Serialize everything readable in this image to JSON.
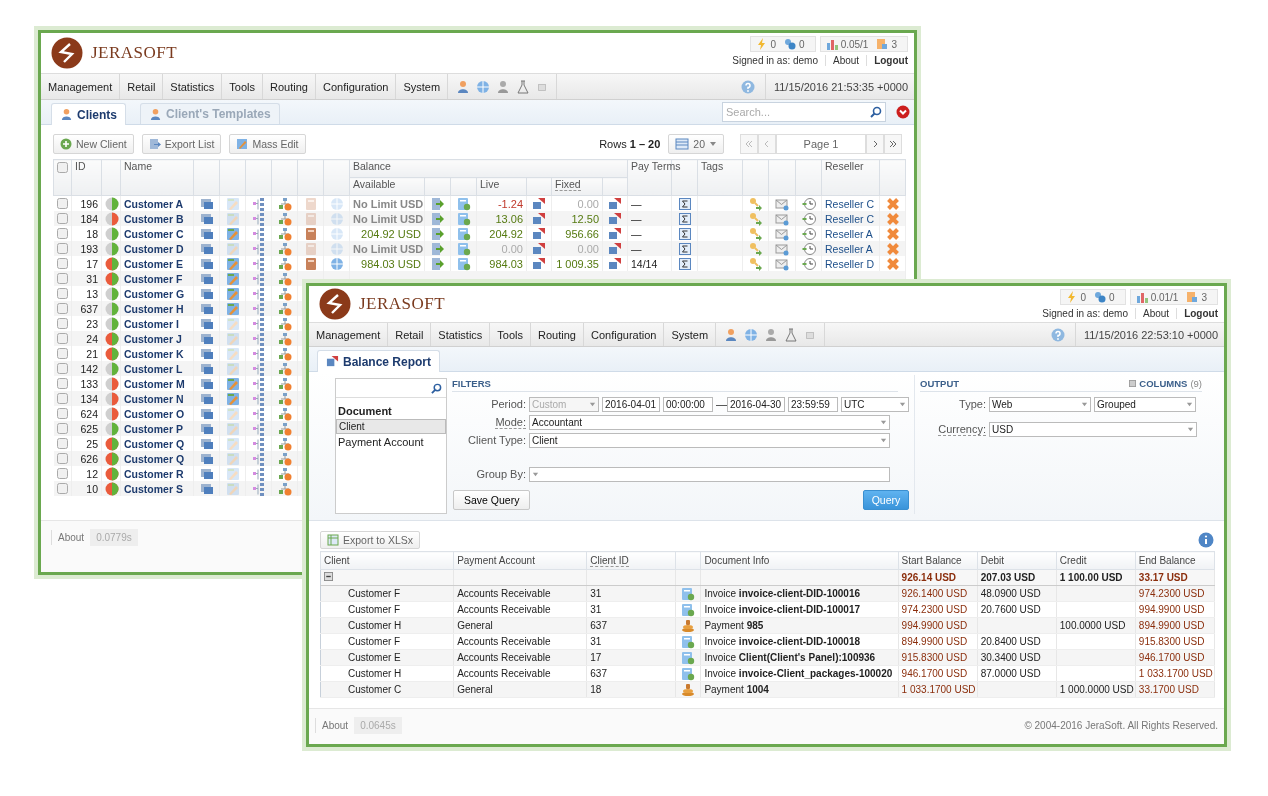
{
  "back": {
    "logo": "JERASOFT",
    "stats": [
      "0",
      "0",
      "0.05/1",
      "3"
    ],
    "signed_in": "Signed in as: demo",
    "about": "About",
    "logout": "Logout",
    "menu": [
      "Management",
      "Retail",
      "Statistics",
      "Tools",
      "Routing",
      "Configuration",
      "System"
    ],
    "datetime": "11/15/2016 21:53:35 +0000",
    "tabs": [
      {
        "label": "Clients",
        "selected": true
      },
      {
        "label": "Client's Templates",
        "selected": false
      }
    ],
    "search": {
      "placeholder": "Search..."
    },
    "buttons": [
      "New Client",
      "Export List",
      "Mass Edit"
    ],
    "rows_info": "Rows **1 – 20**",
    "per_page": "20",
    "page": "Page 1",
    "columns": {
      "id": "ID",
      "name": "Name",
      "balance": "Balance",
      "available": "Available",
      "live": "Live",
      "fixed": "Fixed",
      "pay_terms": "Pay Terms",
      "tags": "Tags",
      "reseller": "Reseller"
    },
    "all_checked": false,
    "rows": [
      {
        "checked": false,
        "id": "196",
        "name": "Customer A",
        "color": "#62b33c",
        "alert": false,
        "edit_enabled": false,
        "notes_enabled": false,
        "globe_enabled": false,
        "available": {
          "text": "No Limit USD",
          "color": "#888888",
          "unlimited": true
        },
        "live": {
          "text": "-1.24",
          "color": "#c0392b"
        },
        "fixed": {
          "text": "0.00",
          "negative": false,
          "zero": true
        },
        "pay_terms": "—",
        "reseller": "Reseller C"
      },
      {
        "checked": false,
        "id": "184",
        "name": "Customer B",
        "color": "#ea5b3c",
        "alert": false,
        "edit_enabled": false,
        "notes_enabled": false,
        "globe_enabled": false,
        "available": {
          "text": "No Limit USD",
          "color": "#888888",
          "unlimited": true
        },
        "live": {
          "text": "13.06",
          "color": "#557a10"
        },
        "fixed": {
          "text": "12.50",
          "negative": false,
          "zero": false
        },
        "pay_terms": "—",
        "reseller": "Reseller C"
      },
      {
        "checked": false,
        "id": "18",
        "name": "Customer C",
        "color": "#62b33c",
        "alert": false,
        "edit_enabled": true,
        "notes_enabled": true,
        "globe_enabled": false,
        "available": {
          "text": "204.92 USD",
          "color": "#557a10",
          "unlimited": false
        },
        "live": {
          "text": "204.92",
          "color": "#557a10"
        },
        "fixed": {
          "text": "956.66",
          "negative": false,
          "zero": false
        },
        "pay_terms": "—",
        "reseller": "Reseller A"
      },
      {
        "checked": false,
        "id": "193",
        "name": "Customer D",
        "color": "#62b33c",
        "alert": false,
        "edit_enabled": false,
        "notes_enabled": false,
        "globe_enabled": false,
        "available": {
          "text": "No Limit USD",
          "color": "#888888",
          "unlimited": true
        },
        "live": {
          "text": "0.00",
          "color": "#aaaaaa"
        },
        "fixed": {
          "text": "0.00",
          "negative": false,
          "zero": true
        },
        "pay_terms": "—",
        "reseller": "Reseller A"
      },
      {
        "checked": false,
        "id": "17",
        "name": "Customer E",
        "color": "#62b33c",
        "alert": true,
        "edit_enabled": true,
        "notes_enabled": true,
        "globe_enabled": true,
        "available": {
          "text": "984.03 USD",
          "color": "#557a10",
          "unlimited": false
        },
        "live": {
          "text": "984.03",
          "color": "#557a10"
        },
        "fixed": {
          "text": "1 009.35",
          "negative": false,
          "zero": false
        },
        "pay_terms": "14/14",
        "reseller": "Reseller D"
      },
      {
        "checked": false,
        "id": "31",
        "name": "Customer F",
        "color": "#62b33c",
        "alert": true,
        "edit_enabled": true
      },
      {
        "checked": false,
        "id": "13",
        "name": "Customer G",
        "color": "#62b33c",
        "alert": false,
        "edit_enabled": true
      },
      {
        "checked": false,
        "id": "637",
        "name": "Customer H",
        "color": "#62b33c",
        "alert": false,
        "edit_enabled": true
      },
      {
        "checked": false,
        "id": "23",
        "name": "Customer I",
        "color": "#62b33c",
        "alert": false,
        "edit_enabled": false
      },
      {
        "checked": false,
        "id": "24",
        "name": "Customer J",
        "color": "#62b33c",
        "alert": true,
        "edit_enabled": false
      },
      {
        "checked": false,
        "id": "21",
        "name": "Customer K",
        "color": "#62b33c",
        "alert": true,
        "edit_enabled": false
      },
      {
        "checked": false,
        "id": "142",
        "name": "Customer L",
        "color": "#62b33c",
        "alert": false,
        "edit_enabled": false
      },
      {
        "checked": false,
        "id": "133",
        "name": "Customer M",
        "color": "#ea5b3c",
        "alert": false,
        "edit_enabled": true
      },
      {
        "checked": false,
        "id": "134",
        "name": "Customer N",
        "color": "#ea5b3c",
        "alert": false,
        "edit_enabled": true
      },
      {
        "checked": false,
        "id": "624",
        "name": "Customer O",
        "color": "#ea5b3c",
        "alert": false,
        "edit_enabled": false
      },
      {
        "checked": false,
        "id": "625",
        "name": "Customer P",
        "color": "#62b33c",
        "alert": false,
        "edit_enabled": false
      },
      {
        "checked": false,
        "id": "25",
        "name": "Customer Q",
        "color": "#62b33c",
        "alert": true,
        "edit_enabled": false
      },
      {
        "checked": false,
        "id": "626",
        "name": "Customer Q",
        "color": "#62b33c",
        "alert": true,
        "edit_enabled": false
      },
      {
        "checked": false,
        "id": "12",
        "name": "Customer R",
        "color": "#62b33c",
        "alert": true,
        "edit_enabled": false
      },
      {
        "checked": false,
        "id": "10",
        "name": "Customer S",
        "color": "#62b33c",
        "alert": true,
        "edit_enabled": false
      }
    ],
    "footer": {
      "about": "About",
      "time": "0.0779s"
    }
  },
  "front": {
    "logo": "JERASOFT",
    "stats": [
      "0",
      "0",
      "0.01/1",
      "3"
    ],
    "signed_in": "Signed in as: demo",
    "about": "About",
    "logout": "Logout",
    "menu": [
      "Management",
      "Retail",
      "Statistics",
      "Tools",
      "Routing",
      "Configuration",
      "System"
    ],
    "datetime": "11/15/2016 22:53:10 +0000",
    "tabs": [
      {
        "label": "Balance Report",
        "selected": true
      }
    ],
    "fields_list": {
      "group": "Document",
      "items": [
        {
          "label": "Client",
          "selected": true
        },
        {
          "label": "Payment Account",
          "selected": false
        }
      ]
    },
    "filters": {
      "title": "FILTERS",
      "period_label": "Period:",
      "period": {
        "value": "Custom",
        "disabled": true
      },
      "date_from": "2016-04-01",
      "time_from": "00:00:00",
      "dash": "—",
      "date_to": "2016-04-30",
      "time_to": "23:59:59",
      "timezone": "UTC",
      "mode_label": "Mode:",
      "mode": "Accountant",
      "client_type_label": "Client Type:",
      "client_type": "Client",
      "group_by_label": "Group By:"
    },
    "save_button": "Save Query",
    "query_button": "Query",
    "output": {
      "title": "OUTPUT",
      "columns_link": "COLUMNS",
      "columns_count": "(9)",
      "type_label": "Type:",
      "type": "Web",
      "grouping": "Grouped",
      "currency_label": "Currency:",
      "currency": "USD"
    },
    "export_button": "Export to XLSx",
    "table": {
      "columns": [
        "Client",
        "Payment Account",
        "Client ID",
        "Document Info",
        "Start Balance",
        "Debit",
        "Credit",
        "End Balance"
      ],
      "totals": {
        "start": "926.14 USD",
        "debit": "207.03 USD",
        "credit": "1 100.00 USD",
        "end": "33.17 USD"
      },
      "rows": [
        {
          "client": "Customer F",
          "account": "Accounts Receivable",
          "client_id": "31",
          "kind": "invoice",
          "info": "Invoice **invoice-client-DID-100016**",
          "start": "926.1400 USD",
          "debit": "48.0900 USD",
          "end": "974.2300 USD"
        },
        {
          "client": "Customer F",
          "account": "Accounts Receivable",
          "client_id": "31",
          "kind": "invoice",
          "info": "Invoice **invoice-client-DID-100017**",
          "start": "974.2300 USD",
          "debit": "20.7600 USD",
          "end": "994.9900 USD"
        },
        {
          "client": "Customer H",
          "account": "General",
          "client_id": "637",
          "kind": "payment",
          "info": "Payment **985**",
          "start": "994.9900 USD",
          "credit": "100.0000 USD",
          "end": "894.9900 USD"
        },
        {
          "client": "Customer F",
          "account": "Accounts Receivable",
          "client_id": "31",
          "kind": "invoice",
          "info": "Invoice **invoice-client-DID-100018**",
          "start": "894.9900 USD",
          "debit": "20.8400 USD",
          "end": "915.8300 USD"
        },
        {
          "client": "Customer E",
          "account": "Accounts Receivable",
          "client_id": "17",
          "kind": "invoice",
          "info": "Invoice **Client(Client's Panel):100936**",
          "start": "915.8300 USD",
          "debit": "30.3400 USD",
          "end": "946.1700 USD"
        },
        {
          "client": "Customer H",
          "account": "Accounts Receivable",
          "client_id": "637",
          "kind": "invoice",
          "info": "Invoice **invoice-Client_packages-100020**",
          "start": "946.1700 USD",
          "debit": "87.0000 USD",
          "end": "1 033.1700 USD"
        },
        {
          "client": "Customer C",
          "account": "General",
          "client_id": "18",
          "kind": "payment",
          "info": "Payment **1004**",
          "start": "1 033.1700 USD",
          "credit": "1 000.0000 USD",
          "end": "33.1700 USD"
        }
      ]
    },
    "footer": {
      "about": "About",
      "time": "0.0645s",
      "copyright": "© 2004-2016 JeraSoft. All Rights Reserved."
    }
  }
}
